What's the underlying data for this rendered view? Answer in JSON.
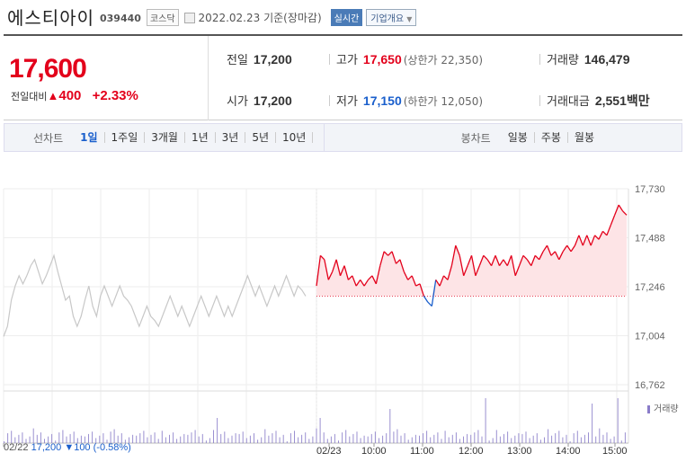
{
  "header": {
    "name": "에스티아이",
    "code": "039440",
    "market": "코스닥",
    "date": "2022.02.23",
    "basis": "기준(장마감)",
    "realtime_label": "실시간",
    "company_label": "기업개요"
  },
  "quote": {
    "price": "17,600",
    "change_label": "전일대비",
    "change_arrow": "▲",
    "change": "400",
    "change_pct": "+2.33%",
    "prev_label": "전일",
    "prev": "17,200",
    "open_label": "시가",
    "open": "17,200",
    "high_label": "고가",
    "high": "17,650",
    "upper_limit": "(상한가 22,350)",
    "low_label": "저가",
    "low": "17,150",
    "lower_limit": "(하한가 12,050)",
    "volume_label": "거래량",
    "volume": "146,479",
    "amount_label": "거래대금",
    "amount": "2,551",
    "amount_unit": "백만",
    "up_color": "#e3001b",
    "down_color": "#1a5fcc"
  },
  "periods": {
    "line_label": "선차트",
    "line_items": [
      "1일",
      "1주일",
      "3개월",
      "1년",
      "3년",
      "5년",
      "10년"
    ],
    "active": "1일",
    "candle_label": "봉차트",
    "candle_items": [
      "일봉",
      "주봉",
      "월봉"
    ]
  },
  "chart_data": {
    "type": "line",
    "y_ticks": [
      "17,730",
      "17,488",
      "17,246",
      "17,004",
      "16,762"
    ],
    "ylim": [
      16762,
      17730
    ],
    "baseline": 17200,
    "x_ticks": [
      "02/22",
      "02/23",
      "10:00",
      "11:00",
      "12:00",
      "13:00",
      "14:00",
      "15:00"
    ],
    "prev_day_series": [
      17000,
      17050,
      17180,
      17250,
      17300,
      17260,
      17300,
      17350,
      17380,
      17320,
      17260,
      17300,
      17350,
      17400,
      17320,
      17250,
      17180,
      17200,
      17100,
      17050,
      17100,
      17180,
      17250,
      17150,
      17100,
      17200,
      17250,
      17200,
      17150,
      17200,
      17250,
      17200,
      17180,
      17150,
      17100,
      17050,
      17100,
      17150,
      17100,
      17080,
      17050,
      17100,
      17150,
      17200,
      17150,
      17100,
      17150,
      17100,
      17050,
      17100,
      17150,
      17200,
      17150,
      17100,
      17150,
      17200,
      17150,
      17100,
      17150,
      17100,
      17150,
      17200,
      17250,
      17300,
      17250,
      17200,
      17250,
      17200,
      17150,
      17200,
      17250,
      17200,
      17250,
      17300,
      17250,
      17200,
      17250,
      17230,
      17200
    ],
    "today_series": [
      17250,
      17400,
      17380,
      17280,
      17320,
      17380,
      17300,
      17350,
      17280,
      17300,
      17250,
      17280,
      17250,
      17280,
      17300,
      17260,
      17350,
      17420,
      17400,
      17420,
      17360,
      17380,
      17320,
      17280,
      17300,
      17250,
      17260,
      17200,
      17170,
      17150,
      17280,
      17250,
      17300,
      17280,
      17350,
      17450,
      17400,
      17300,
      17350,
      17400,
      17300,
      17350,
      17400,
      17380,
      17350,
      17400,
      17350,
      17380,
      17350,
      17400,
      17300,
      17350,
      17400,
      17380,
      17350,
      17400,
      17380,
      17420,
      17450,
      17400,
      17420,
      17380,
      17420,
      17450,
      17420,
      17450,
      17500,
      17450,
      17500,
      17450,
      17500,
      17480,
      17520,
      17500,
      17550,
      17600,
      17650,
      17620,
      17600
    ],
    "volume_label": "거래량",
    "volume_color": "#8a7cc9",
    "price_line_color": "#e3001b",
    "fill_color": "#fde4e6"
  },
  "footer": {
    "date": "02/22",
    "price": "17,200",
    "change": "▼100",
    "pct": "(-0.58%)"
  }
}
